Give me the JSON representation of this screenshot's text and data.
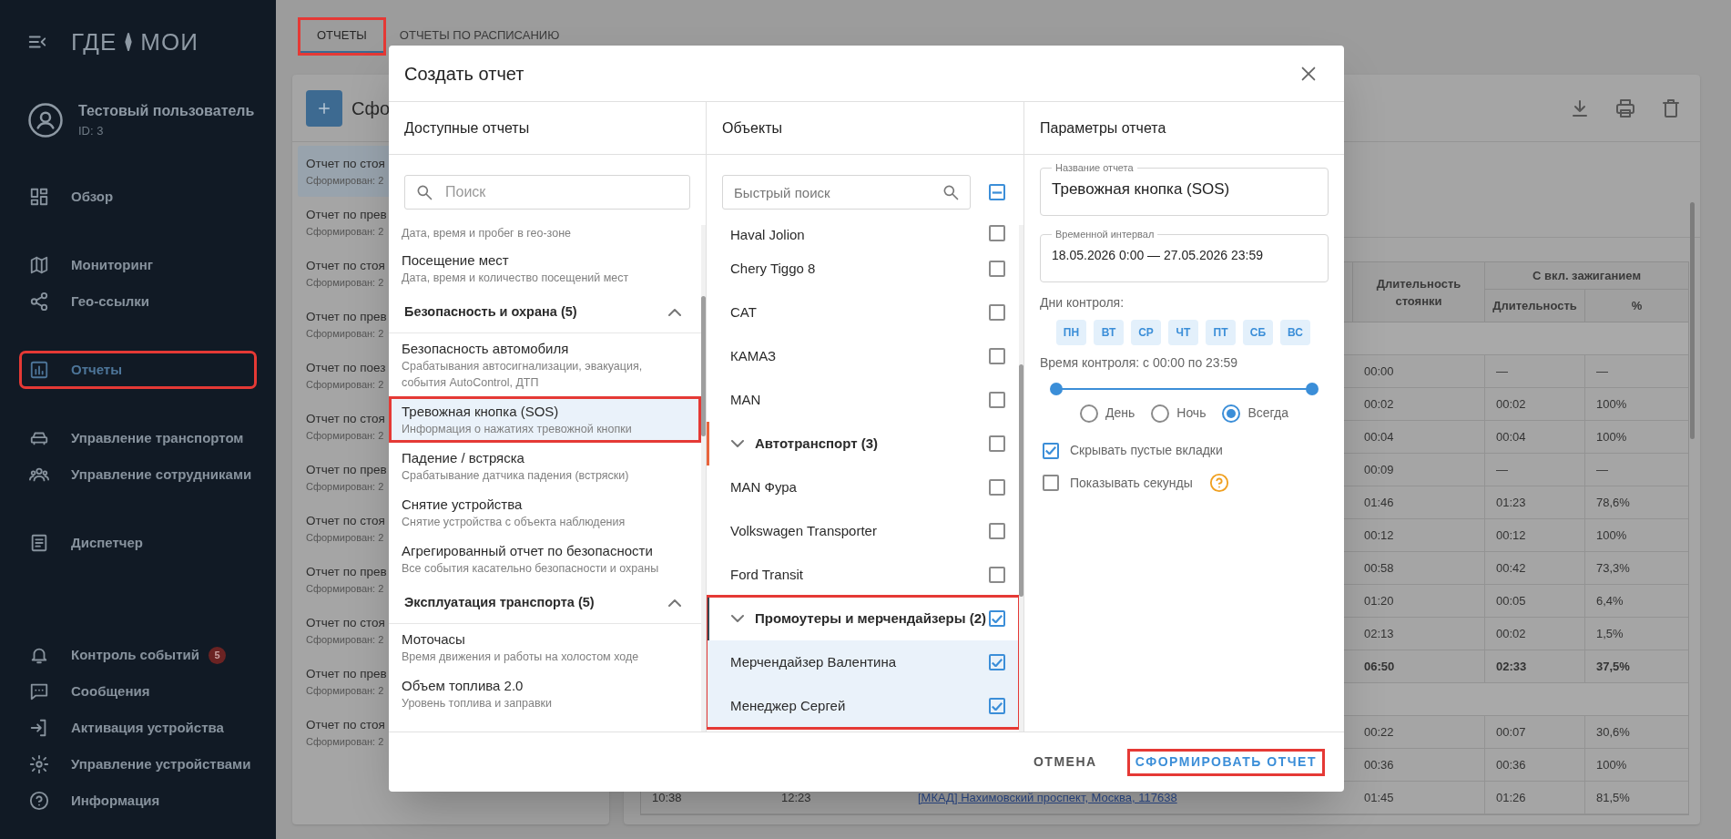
{
  "sidebar": {
    "logo": {
      "left": "ГДЕ",
      "right": "МОИ"
    },
    "user": {
      "name": "Тестовый пользователь",
      "id": "ID: 3"
    },
    "nav_groups": [
      [
        {
          "label": "Обзор",
          "selected": false,
          "highlighted": false
        }
      ],
      [
        {
          "label": "Мониторинг",
          "selected": false,
          "highlighted": false
        },
        {
          "label": "Гео-ссылки",
          "selected": false,
          "highlighted": false
        }
      ],
      [
        {
          "label": "Отчеты",
          "selected": true,
          "highlighted": true
        }
      ],
      [
        {
          "label": "Управление транспортом",
          "selected": false,
          "highlighted": false
        },
        {
          "label": "Управление сотрудниками",
          "selected": false,
          "highlighted": false
        }
      ],
      [
        {
          "label": "Диспетчер",
          "selected": false,
          "highlighted": false
        }
      ]
    ],
    "bottom_nav": [
      {
        "label": "Контроль событий",
        "badge": "5",
        "selected": false,
        "highlighted": false
      },
      {
        "label": "Сообщения",
        "selected": false,
        "highlighted": false
      },
      {
        "label": "Активация устройства",
        "selected": false,
        "highlighted": false
      },
      {
        "label": "Управление устройствами",
        "selected": false,
        "highlighted": false
      },
      {
        "label": "Информация",
        "selected": false,
        "highlighted": false
      }
    ]
  },
  "tabs": [
    {
      "label": "ОТЧЕТЫ",
      "selected": true,
      "highlighted": true
    },
    {
      "label": "ОТЧЕТЫ ПО РАСПИСАНИЮ",
      "selected": false,
      "highlighted": false
    }
  ],
  "reports_panel": {
    "title": "Сфо",
    "items": [
      {
        "title": "Отчет по стоя",
        "subtitle": "Сформирован: 2",
        "selected": true
      },
      {
        "title": "Отчет по прев",
        "subtitle": "Сформирован: 2",
        "selected": false
      },
      {
        "title": "Отчет по стоя",
        "subtitle": "Сформирован: 2",
        "selected": false
      },
      {
        "title": "Отчет по прев",
        "subtitle": "Сформирован: 2",
        "selected": false
      },
      {
        "title": "Отчет по поез",
        "subtitle": "Сформирован: 2",
        "selected": false
      },
      {
        "title": "Отчет по стоя",
        "subtitle": "Сформирован: 2",
        "selected": false
      },
      {
        "title": "Отчет по прев",
        "subtitle": "Сформирован: 2",
        "selected": false
      },
      {
        "title": "Отчет по стоя",
        "subtitle": "Сформирован: 2",
        "selected": false
      },
      {
        "title": "Отчет по прев",
        "subtitle": "Сформирован: 2",
        "selected": false
      },
      {
        "title": "Отчет по стоя",
        "subtitle": "Сформирован: 2",
        "selected": false
      },
      {
        "title": "Отчет по прев",
        "subtitle": "Сформирован: 2",
        "selected": false
      },
      {
        "title": "Отчет по стоя",
        "subtitle": "Сформирован: 2",
        "selected": false
      }
    ]
  },
  "table": {
    "header": {
      "parking_duration": "Длительность стоянки",
      "ignition_group": "С вкл. зажиганием",
      "ignition_duration": "Длительность",
      "ignition_percent": "%"
    },
    "rows": [
      {
        "kind": "group"
      },
      {
        "kind": "data",
        "parking_duration": "00:00",
        "ignition_duration": "—",
        "ignition_percent": "—"
      },
      {
        "kind": "data",
        "parking_duration": "00:02",
        "ignition_duration": "00:02",
        "ignition_percent": "100%"
      },
      {
        "kind": "data",
        "parking_duration": "00:04",
        "ignition_duration": "00:04",
        "ignition_percent": "100%"
      },
      {
        "kind": "data",
        "parking_duration": "00:09",
        "ignition_duration": "—",
        "ignition_percent": "—"
      },
      {
        "kind": "data",
        "parking_duration": "01:46",
        "ignition_duration": "01:23",
        "ignition_percent": "78,6%"
      },
      {
        "kind": "data",
        "parking_duration": "00:12",
        "ignition_duration": "00:12",
        "ignition_percent": "100%"
      },
      {
        "kind": "data",
        "parking_duration": "00:58",
        "ignition_duration": "00:42",
        "ignition_percent": "73,3%"
      },
      {
        "kind": "data",
        "parking_duration": "01:20",
        "ignition_duration": "00:05",
        "ignition_percent": "6,4%"
      },
      {
        "kind": "data",
        "parking_duration": "02:13",
        "ignition_duration": "00:02",
        "ignition_percent": "1,5%"
      },
      {
        "kind": "total",
        "parking_duration": "06:50",
        "ignition_duration": "02:33",
        "ignition_percent": "37,5%"
      },
      {
        "kind": "group"
      },
      {
        "kind": "data",
        "parking_duration": "00:22",
        "ignition_duration": "00:07",
        "ignition_percent": "30,6%"
      },
      {
        "kind": "data",
        "parking_duration": "00:36",
        "ignition_duration": "00:36",
        "ignition_percent": "100%"
      },
      {
        "kind": "data",
        "column_1": "10:38",
        "column_2": "12:23",
        "column_3": "[МКАД] Нахимовский проспект, Москва, 117638",
        "parking_duration": "01:45",
        "ignition_duration": "01:26",
        "ignition_percent": "81,5%"
      }
    ]
  },
  "dialog": {
    "title": "Создать отчет",
    "reports": {
      "title": "Доступные отчеты",
      "search_placeholder": "Поиск",
      "items": [
        {
          "kind": "item",
          "subtitle": "Дата, время и пробег в гео-зоне",
          "selected": false,
          "highlighted": false
        },
        {
          "kind": "item",
          "title": "Посещение мест",
          "subtitle": "Дата, время и количество посещений мест",
          "selected": false,
          "highlighted": false
        },
        {
          "kind": "group",
          "label": "Безопасность и охрана (5)",
          "expanded": true,
          "children": [
            {
              "kind": "item",
              "title": "Безопасность автомобиля",
              "subtitle": "Срабатывания автосигнализации, эвакуация, события AutoControl, ДТП",
              "selected": false,
              "highlighted": false
            },
            {
              "kind": "item",
              "title": "Тревожная кнопка (SOS)",
              "subtitle": "Информация о нажатиях тревожной кнопки",
              "selected": true,
              "highlighted": true
            },
            {
              "kind": "item",
              "title": "Падение / встряска",
              "subtitle": "Срабатывание датчика падения (встряски)",
              "selected": false,
              "highlighted": false
            },
            {
              "kind": "item",
              "title": "Снятие устройства",
              "subtitle": "Снятие устройства с объекта наблюдения",
              "selected": false,
              "highlighted": false
            },
            {
              "kind": "item",
              "title": "Агрегированный отчет по безопасности",
              "subtitle": "Все события касательно безопасности и охраны",
              "selected": false,
              "highlighted": false
            }
          ]
        },
        {
          "kind": "group",
          "label": "Эксплуатация транспорта (5)",
          "expanded": true,
          "children": [
            {
              "kind": "item",
              "title": "Моточасы",
              "subtitle": "Время движения и работы на холостом ходе",
              "selected": false,
              "highlighted": false
            },
            {
              "kind": "item",
              "title": "Объем топлива 2.0",
              "subtitle": "Уровень топлива и заправки",
              "selected": false,
              "highlighted": false
            }
          ]
        }
      ]
    },
    "objects": {
      "title": "Объекты",
      "search_placeholder": "Быстрый поиск",
      "select_all": {
        "indeterminate": true
      },
      "items": [
        {
          "kind": "item",
          "label": "Haval Jolion",
          "checked": false,
          "selected": false
        },
        {
          "kind": "item",
          "label": "Chery Tiggo 8",
          "checked": false,
          "selected": false
        },
        {
          "kind": "item",
          "label": "CAT",
          "checked": false,
          "selected": false
        },
        {
          "kind": "item",
          "label": "КАМАЗ",
          "checked": false,
          "selected": false
        },
        {
          "kind": "item",
          "label": "MAN",
          "checked": false,
          "selected": false
        },
        {
          "kind": "group",
          "label": "Автотранспорт (3)",
          "checked": false,
          "expanded": true,
          "highlighted": false,
          "color": "#e8643c",
          "children": [
            {
              "kind": "item",
              "label": "MAN Фура",
              "checked": false,
              "selected": false
            },
            {
              "kind": "item",
              "label": "Volkswagen Transporter",
              "checked": false,
              "selected": false
            },
            {
              "kind": "item",
              "label": "Ford Transit",
              "checked": false,
              "selected": false
            }
          ]
        },
        {
          "kind": "group",
          "label": "Промоутеры и мерчендайзеры (2)",
          "checked": true,
          "expanded": true,
          "highlighted": true,
          "color": "#37474f",
          "children": [
            {
              "kind": "item",
              "label": "Мерчендайзер Валентина",
              "checked": true,
              "selected": true
            },
            {
              "kind": "item",
              "label": "Менеджер Сергей",
              "checked": true,
              "selected": true
            }
          ]
        }
      ]
    },
    "params": {
      "title": "Параметры отчета",
      "fields": [
        {
          "label": "Название отчета",
          "value": "Тревожная кнопка (SOS)"
        },
        {
          "label": "Временной интервал",
          "value": "18.05.2026 0:00 — 27.05.2026 23:59"
        }
      ],
      "days_label": "Дни контроля:",
      "days": [
        {
          "label": "ПН",
          "selected": true
        },
        {
          "label": "ВТ",
          "selected": true
        },
        {
          "label": "СР",
          "selected": true
        },
        {
          "label": "ЧТ",
          "selected": true
        },
        {
          "label": "ПТ",
          "selected": true
        },
        {
          "label": "СБ",
          "selected": true
        },
        {
          "label": "ВС",
          "selected": true
        }
      ],
      "time_label": "Время контроля: с 00:00 по 23:59",
      "slider": {
        "thumbs": [
          {
            "level": 0
          },
          {
            "level": 1
          }
        ]
      },
      "modes": [
        {
          "label": "День",
          "selected": false
        },
        {
          "label": "Ночь",
          "selected": false
        },
        {
          "label": "Всегда",
          "selected": true
        }
      ],
      "options": [
        {
          "label": "Скрывать пустые вкладки",
          "checked": true,
          "help": false
        },
        {
          "label": "Показывать секунды",
          "checked": false,
          "help": true
        }
      ]
    },
    "actions": [
      {
        "label": "ОТМЕНА",
        "kind": "secondary",
        "highlighted": false
      },
      {
        "label": "СФОРМИРОВАТЬ ОТЧЕТ",
        "kind": "primary",
        "highlighted": true
      }
    ]
  }
}
